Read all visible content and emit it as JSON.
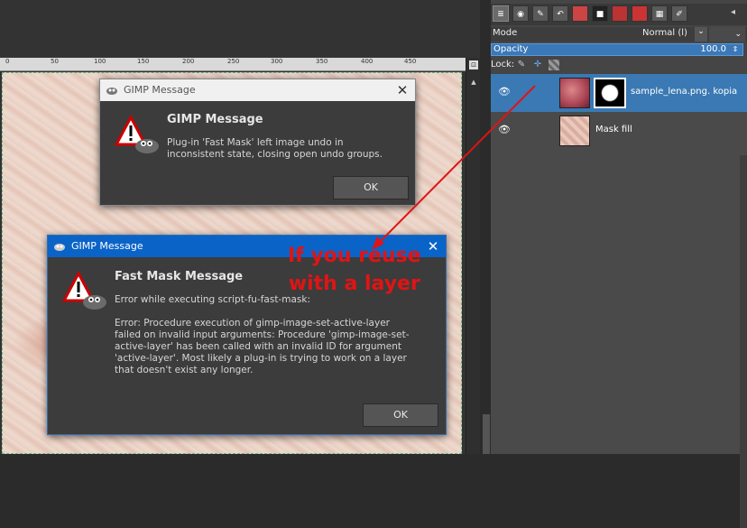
{
  "ruler": {
    "ticks": [
      "0",
      "50",
      "100",
      "150",
      "200",
      "250",
      "300",
      "350",
      "400",
      "450"
    ]
  },
  "panel": {
    "tabs": [
      "layers",
      "channels",
      "paths",
      "undo",
      "brushes",
      "patterns",
      "gradients",
      "fonts",
      "colors",
      "tools"
    ],
    "mode": {
      "label": "Mode",
      "value": "Normal (l)"
    },
    "opacity": {
      "label": "Opacity",
      "value": "100.0"
    },
    "lock": {
      "label": "Lock:"
    },
    "layers": [
      {
        "name": "sample_lena.png. kopia",
        "selected": true,
        "visible": true
      },
      {
        "name": "Mask fill",
        "selected": false,
        "visible": true
      }
    ]
  },
  "dialog1": {
    "title": "GIMP Message",
    "heading": "GIMP Message",
    "message": "Plug-in 'Fast Mask' left image undo in\ninconsistent state, closing open undo groups.",
    "ok_label": "OK"
  },
  "dialog2": {
    "title": "GIMP Message",
    "heading": "Fast Mask Message",
    "message": "Error while executing script-fu-fast-mask:\n\nError: Procedure execution of gimp-image-set-active-layer\nfailed on invalid input arguments: Procedure 'gimp-image-set-\nactive-layer' has been called with an invalid ID for argument\n'active-layer'. Most likely a plug-in is trying to work on a layer\nthat doesn't exist any longer.",
    "ok_label": "OK"
  },
  "annotation": {
    "line1": "If you reuse",
    "line2": "with a layer",
    "color": "#e01414"
  },
  "colors": {
    "selection": "#3a79b3",
    "dialog_title_active": "#0a63c7"
  }
}
